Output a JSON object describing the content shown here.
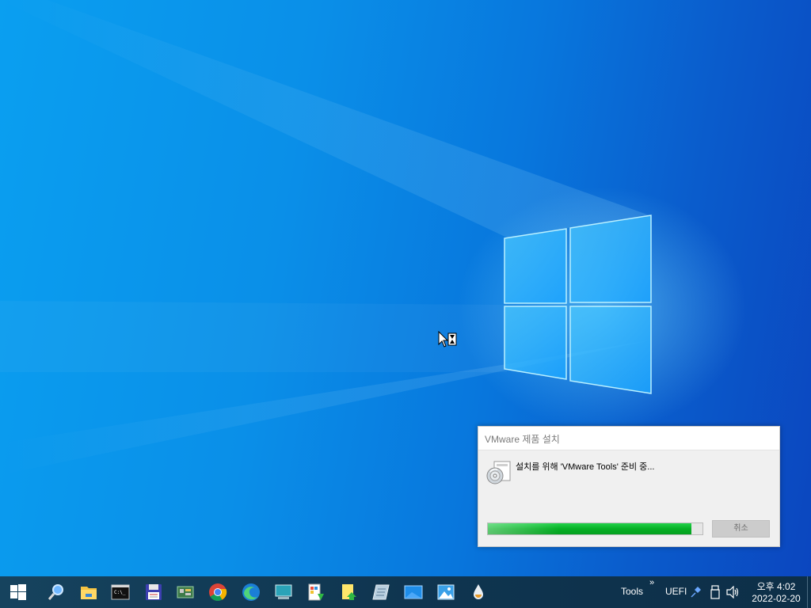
{
  "dialog": {
    "title": "VMware 제품 설치",
    "message": "설치를 위해 'VMware Tools' 준비 중...",
    "progress_percent": 95,
    "cancel_label": "취소"
  },
  "taskbar": {
    "apps": [
      {
        "name": "search",
        "icon": "search-icon"
      },
      {
        "name": "file-explorer",
        "icon": "folder-icon"
      },
      {
        "name": "command-prompt",
        "icon": "terminal-icon"
      },
      {
        "name": "save",
        "icon": "floppy-disk-icon"
      },
      {
        "name": "hardware",
        "icon": "circuit-board-icon"
      },
      {
        "name": "chrome",
        "icon": "chrome-icon"
      },
      {
        "name": "edge",
        "icon": "edge-icon"
      },
      {
        "name": "display",
        "icon": "monitor-icon"
      },
      {
        "name": "installer",
        "icon": "install-package-icon"
      },
      {
        "name": "notes",
        "icon": "note-upload-icon"
      },
      {
        "name": "partition",
        "icon": "disk-tool-icon"
      },
      {
        "name": "remote",
        "icon": "screen-icon"
      },
      {
        "name": "photos",
        "icon": "photo-icon"
      },
      {
        "name": "dropper",
        "icon": "droplet-icon"
      }
    ],
    "tray": {
      "toolbar_label": "Tools",
      "chevron": "»",
      "boot_mode": "UEFI",
      "time": "오후 4:02",
      "date": "2022-02-20"
    }
  },
  "colors": {
    "taskbar": "#0f3a52",
    "progress": "#06b025",
    "desktop": "#0a8fe8"
  }
}
